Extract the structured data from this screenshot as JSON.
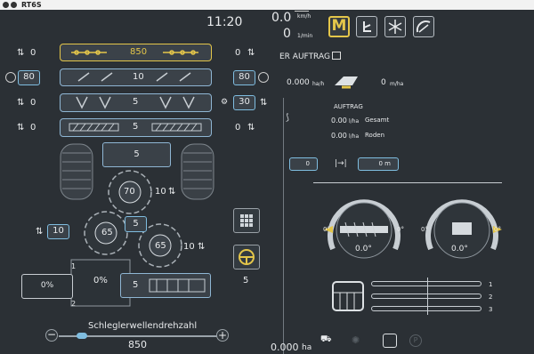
{
  "window": {
    "title": "RT6S"
  },
  "header": {
    "time": "11:20",
    "speed_value": "0.0",
    "speed_unit": "km/h",
    "rpm_value": "0",
    "rpm_unit": "1/min",
    "mode_label": "M"
  },
  "left": {
    "row1": {
      "left_value": "0",
      "center_value": "850",
      "right_value": "0"
    },
    "row2": {
      "left_value": "80",
      "center_value": "10",
      "right_value": "80"
    },
    "row3": {
      "left_value": "0",
      "center_value": "5",
      "right_value": "30"
    },
    "row4": {
      "left_value": "0",
      "center_value": "5",
      "right_value": "0"
    },
    "conveyor_value": "5",
    "rotor_top_value": "70",
    "rotor_top_side": "10",
    "rotor_left_value": "65",
    "rotor_right_value": "65",
    "rotor_right_side": "10",
    "rotor_left_side": "10",
    "rotor_mid_value": "5",
    "steering_value": "5",
    "left_box_value": "0%",
    "center_box_value": "0%",
    "center_box_top_mark": "1",
    "center_box_bottom_mark": "2",
    "bottom_right_value": "5",
    "slider_label": "Schleglerwellendrehzahl",
    "slider_value": "850",
    "slider_fraction": 0.12
  },
  "right": {
    "order_title": "ER AUFTRAG",
    "area_rate": "0.000",
    "area_rate_unit": "ha/h",
    "yield_rate": "0",
    "yield_unit": "m/ha",
    "auftrag_label": "AUFTRAG",
    "gesamt_value": "0.00",
    "gesamt_unit": "l/ha",
    "gesamt_label": "Gesamt",
    "roden_value": "0.00",
    "roden_unit": "l/ha",
    "roden_label": "Roden",
    "field_left": "0",
    "field_right": "0 m",
    "gauge_left_angle": "0.0°",
    "gauge_left_side_left": "0°",
    "gauge_left_side_right": "0°",
    "gauge_right_angle": "0.0°",
    "gauge_right_side_left": "0°",
    "gauge_right_side_right": "0°",
    "lane1": "1",
    "lane2": "2",
    "lane3": "3",
    "bottom_area": "0.000",
    "bottom_area_unit": "ha"
  },
  "colors": {
    "accent": "#e4c64a",
    "blue": "#7fbde0",
    "bg": "#2b3035"
  }
}
